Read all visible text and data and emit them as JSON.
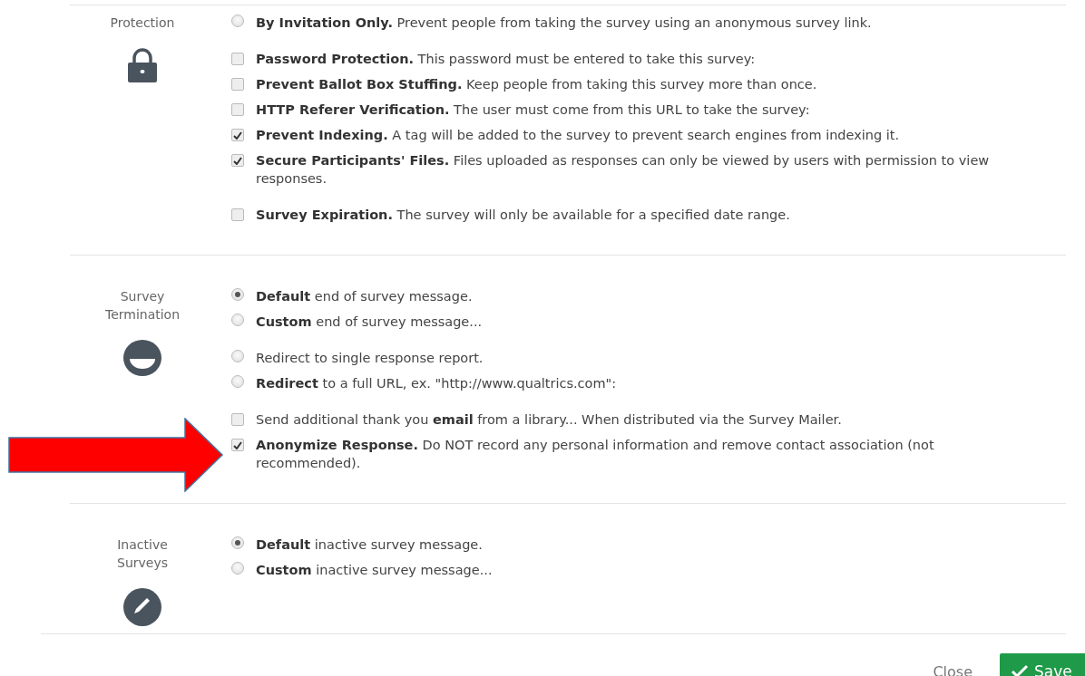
{
  "sections": [
    {
      "label": [
        "Protection"
      ],
      "groups": [
        [
          {
            "kind": "radio",
            "selected": false,
            "text": "**By Invitation Only.** Prevent people from taking the survey using an anonymous survey link."
          }
        ],
        [
          {
            "kind": "checkbox",
            "checked": false,
            "text": "**Password Protection.** This password must be entered to take this survey:"
          },
          {
            "kind": "checkbox",
            "checked": false,
            "text": "**Prevent Ballot Box Stuffing.** Keep people from taking this survey more than once."
          },
          {
            "kind": "checkbox",
            "checked": false,
            "text": "**HTTP Referer Verification.** The user must come from this URL to take the survey:"
          },
          {
            "kind": "checkbox",
            "checked": true,
            "text": "**Prevent Indexing.** A tag will be added to the survey to prevent search engines from indexing it."
          },
          {
            "kind": "checkbox",
            "checked": true,
            "text": "**Secure Participants' Files.** Files uploaded as responses can only be viewed by users with permission to view responses."
          }
        ],
        [
          {
            "kind": "checkbox",
            "checked": false,
            "text": "**Survey Expiration.** The survey will only be available for a specified date range."
          }
        ]
      ]
    },
    {
      "label": [
        "Survey",
        "Termination"
      ],
      "groups": [
        [
          {
            "kind": "radio",
            "selected": true,
            "text": "**Default** end of survey message."
          },
          {
            "kind": "radio",
            "selected": false,
            "text": "**Custom** end of survey message..."
          }
        ],
        [
          {
            "kind": "radio",
            "selected": false,
            "text": "Redirect to single response report."
          },
          {
            "kind": "radio",
            "selected": false,
            "text": "**Redirect** to a full URL, ex. \"http://www.qualtrics.com\":"
          }
        ],
        [
          {
            "kind": "checkbox",
            "checked": false,
            "text": "Send additional thank you **email** from a library... When distributed via the Survey Mailer."
          },
          {
            "kind": "checkbox",
            "checked": true,
            "text": "**Anonymize Response.** Do NOT record any personal information and remove contact association (not recommended)."
          }
        ]
      ]
    },
    {
      "label": [
        "Inactive",
        "Surveys"
      ],
      "groups": [
        [
          {
            "kind": "radio",
            "selected": true,
            "text": "**Default** inactive survey message."
          },
          {
            "kind": "radio",
            "selected": false,
            "text": "**Custom** inactive survey message..."
          }
        ]
      ]
    }
  ],
  "footer": {
    "close": "Close",
    "save": "Save"
  }
}
